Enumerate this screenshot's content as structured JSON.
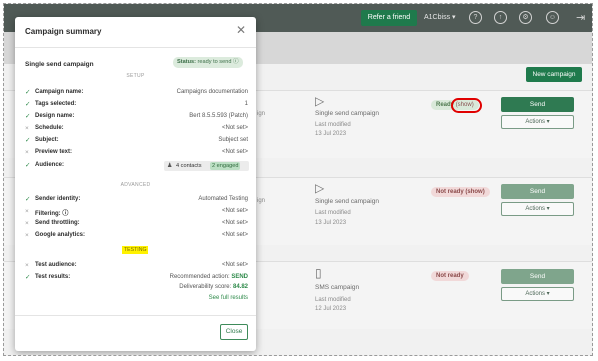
{
  "topbar": {
    "refer_label": "Refer a friend",
    "account_label": "A1Cbiss ▾",
    "icons": [
      "question-icon",
      "up-arrow-icon",
      "gear-icon",
      "user-icon",
      "exit-icon"
    ],
    "icon_glyphs": [
      "?",
      "↑",
      "⚙",
      "☺",
      "⇥"
    ]
  },
  "page": {
    "new_campaign_label": "New campaign",
    "left_edge_fragment": "a",
    "rows": [
      {
        "fragment": "ign",
        "icon": "▷",
        "name": "Single send campaign",
        "last_modified_label": "Last modified",
        "date": "13 Jul 2023",
        "status_main": "Ready",
        "status_show": "(show)",
        "send_label": "Send",
        "actions_label": "Actions ▾"
      },
      {
        "fragment": "ign",
        "icon": "▷",
        "name": "Single send campaign",
        "last_modified_label": "Last modified",
        "date": "13 Jul 2023",
        "status_main": "Not ready",
        "status_show": "(show)",
        "send_label": "Send",
        "actions_label": "Actions ▾"
      },
      {
        "fragment": "",
        "icon": "▯",
        "name": "SMS campaign",
        "last_modified_label": "Last modified",
        "date": "12 Jul 2023",
        "status_main": "Not ready",
        "status_show": "",
        "send_label": "Send",
        "actions_label": "Actions ▾"
      }
    ]
  },
  "modal": {
    "title": "Campaign summary",
    "close_glyph": "✕",
    "campaign_type": "Single send campaign",
    "status_prefix": "Status:",
    "status_value": "ready to send",
    "status_icon": "ⓘ",
    "sections": {
      "setup": "SETUP",
      "advanced": "ADVANCED",
      "testing": "TESTING"
    },
    "setup_rows": [
      {
        "ok": true,
        "label": "Campaign name:",
        "value": "Campaigns documentation"
      },
      {
        "ok": true,
        "label": "Tags selected:",
        "value": "1"
      },
      {
        "ok": true,
        "label": "Design name:",
        "value": "Bert 8.5.5.593 (Patch)"
      },
      {
        "ok": false,
        "label": "Schedule:",
        "value": "<Not set>"
      },
      {
        "ok": true,
        "label": "Subject:",
        "value": "Subject set"
      },
      {
        "ok": false,
        "label": "Preview text:",
        "value": "<Not set>"
      },
      {
        "ok": true,
        "label": "Audience:",
        "value": ""
      }
    ],
    "audience": {
      "contacts": "4 contacts",
      "engaged": "2 engaged"
    },
    "advanced_rows": [
      {
        "ok": true,
        "label": "Sender identity:",
        "value": "Automated Testing"
      },
      {
        "ok": false,
        "label": "Filtering: ⓘ",
        "value": "<Not set>"
      },
      {
        "ok": false,
        "label": "Send throttling:",
        "value": "<Not set>"
      },
      {
        "ok": false,
        "label": "Google analytics:",
        "value": "<Not set>"
      }
    ],
    "testing_rows": [
      {
        "ok": false,
        "label": "Test audience:",
        "value": "<Not set>"
      },
      {
        "ok": true,
        "label": "Test results:",
        "value": ""
      }
    ],
    "test_results": {
      "recommended_label": "Recommended action:",
      "recommended_value": "SEND",
      "score_label": "Deliverability score:",
      "score_value": "84.82",
      "link": "See full results"
    },
    "close_label": "Close"
  },
  "colors": {
    "brand_green": "#1f7a4c",
    "ok_check": "#2e8a4a",
    "highlight_yellow": "#fff200",
    "annotation_red": "#e00000"
  }
}
